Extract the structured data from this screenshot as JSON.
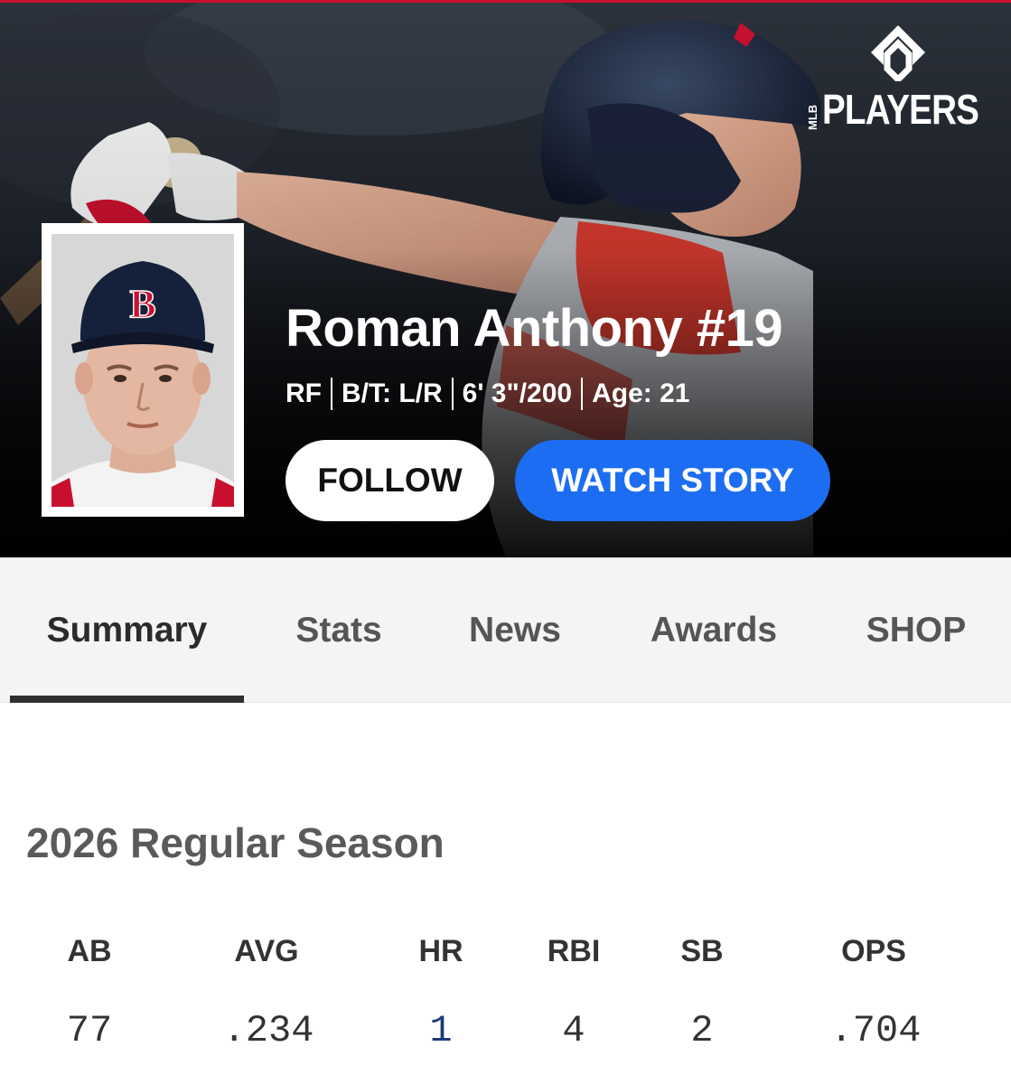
{
  "brand": {
    "mlb": "MLB",
    "word": "PLAYERS"
  },
  "player": {
    "name": "Roman Anthony #19",
    "position": "RF",
    "bats_throws": "B/T: L/R",
    "height_weight": "6' 3\"/200",
    "age": "Age: 21"
  },
  "buttons": {
    "follow": "FOLLOW",
    "watch_story": "WATCH STORY"
  },
  "tabs": [
    {
      "label": "Summary",
      "active": true
    },
    {
      "label": "Stats",
      "active": false
    },
    {
      "label": "News",
      "active": false
    },
    {
      "label": "Awards",
      "active": false
    },
    {
      "label": "SHOP",
      "active": false
    }
  ],
  "season": {
    "title": "2026 Regular Season",
    "headers": [
      "AB",
      "AVG",
      "HR",
      "RBI",
      "SB",
      "OPS"
    ],
    "values": [
      "77",
      ".234",
      "1",
      "4",
      "2",
      ".704"
    ]
  },
  "colors": {
    "accent_blue": "#1d6df2",
    "team_red": "#c8102e",
    "link_navy": "#1a3a7a"
  }
}
